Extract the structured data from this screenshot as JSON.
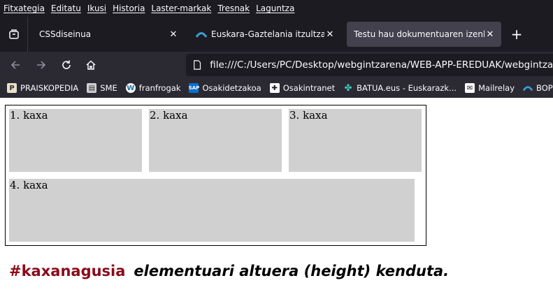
{
  "menu": [
    "Fitxategia",
    "Editatu",
    "Ikusi",
    "Historia",
    "Laster-markak",
    "Tresnak",
    "Laguntza"
  ],
  "tabs": [
    {
      "title": "CSSdiseinua",
      "active": false
    },
    {
      "title": "Euskara-Gaztelania itzultzaile automatikoa",
      "active": false
    },
    {
      "title": "Testu hau dokumentuaren izenburua da",
      "active": true
    }
  ],
  "new_tab_label": "+",
  "url": "file:///C:/Users/PC/Desktop/webgintzarena/WEB-APP-EREDUAK/webgintzakopiaberria",
  "bookmarks": [
    {
      "label": "PRAISKOPEDIA",
      "icon": "praiskopedia-icon"
    },
    {
      "label": "SME",
      "icon": "film-icon"
    },
    {
      "label": "franfrogak",
      "icon": "wordpress-icon"
    },
    {
      "label": "Osakidetzakoa",
      "icon": "sap-icon"
    },
    {
      "label": "Osakintranet",
      "icon": "osakidetza-icon"
    },
    {
      "label": "BATUA.eus - Euskarazk...",
      "icon": "batua-icon"
    },
    {
      "label": "Mailrelay",
      "icon": "mail-icon"
    },
    {
      "label": "BOPV",
      "icon": "bopv-icon"
    }
  ],
  "boxes": [
    "1. kaxa",
    "2. kaxa",
    "3. kaxa",
    "4. kaxa"
  ],
  "note": {
    "selector": "#kaxanagusia",
    "text": "elementuari altuera (height) kenduta."
  },
  "colors": {
    "selector": "#8b0a1a",
    "box_bg": "#d0d0d0",
    "chrome_dark": "#1c1b22"
  }
}
